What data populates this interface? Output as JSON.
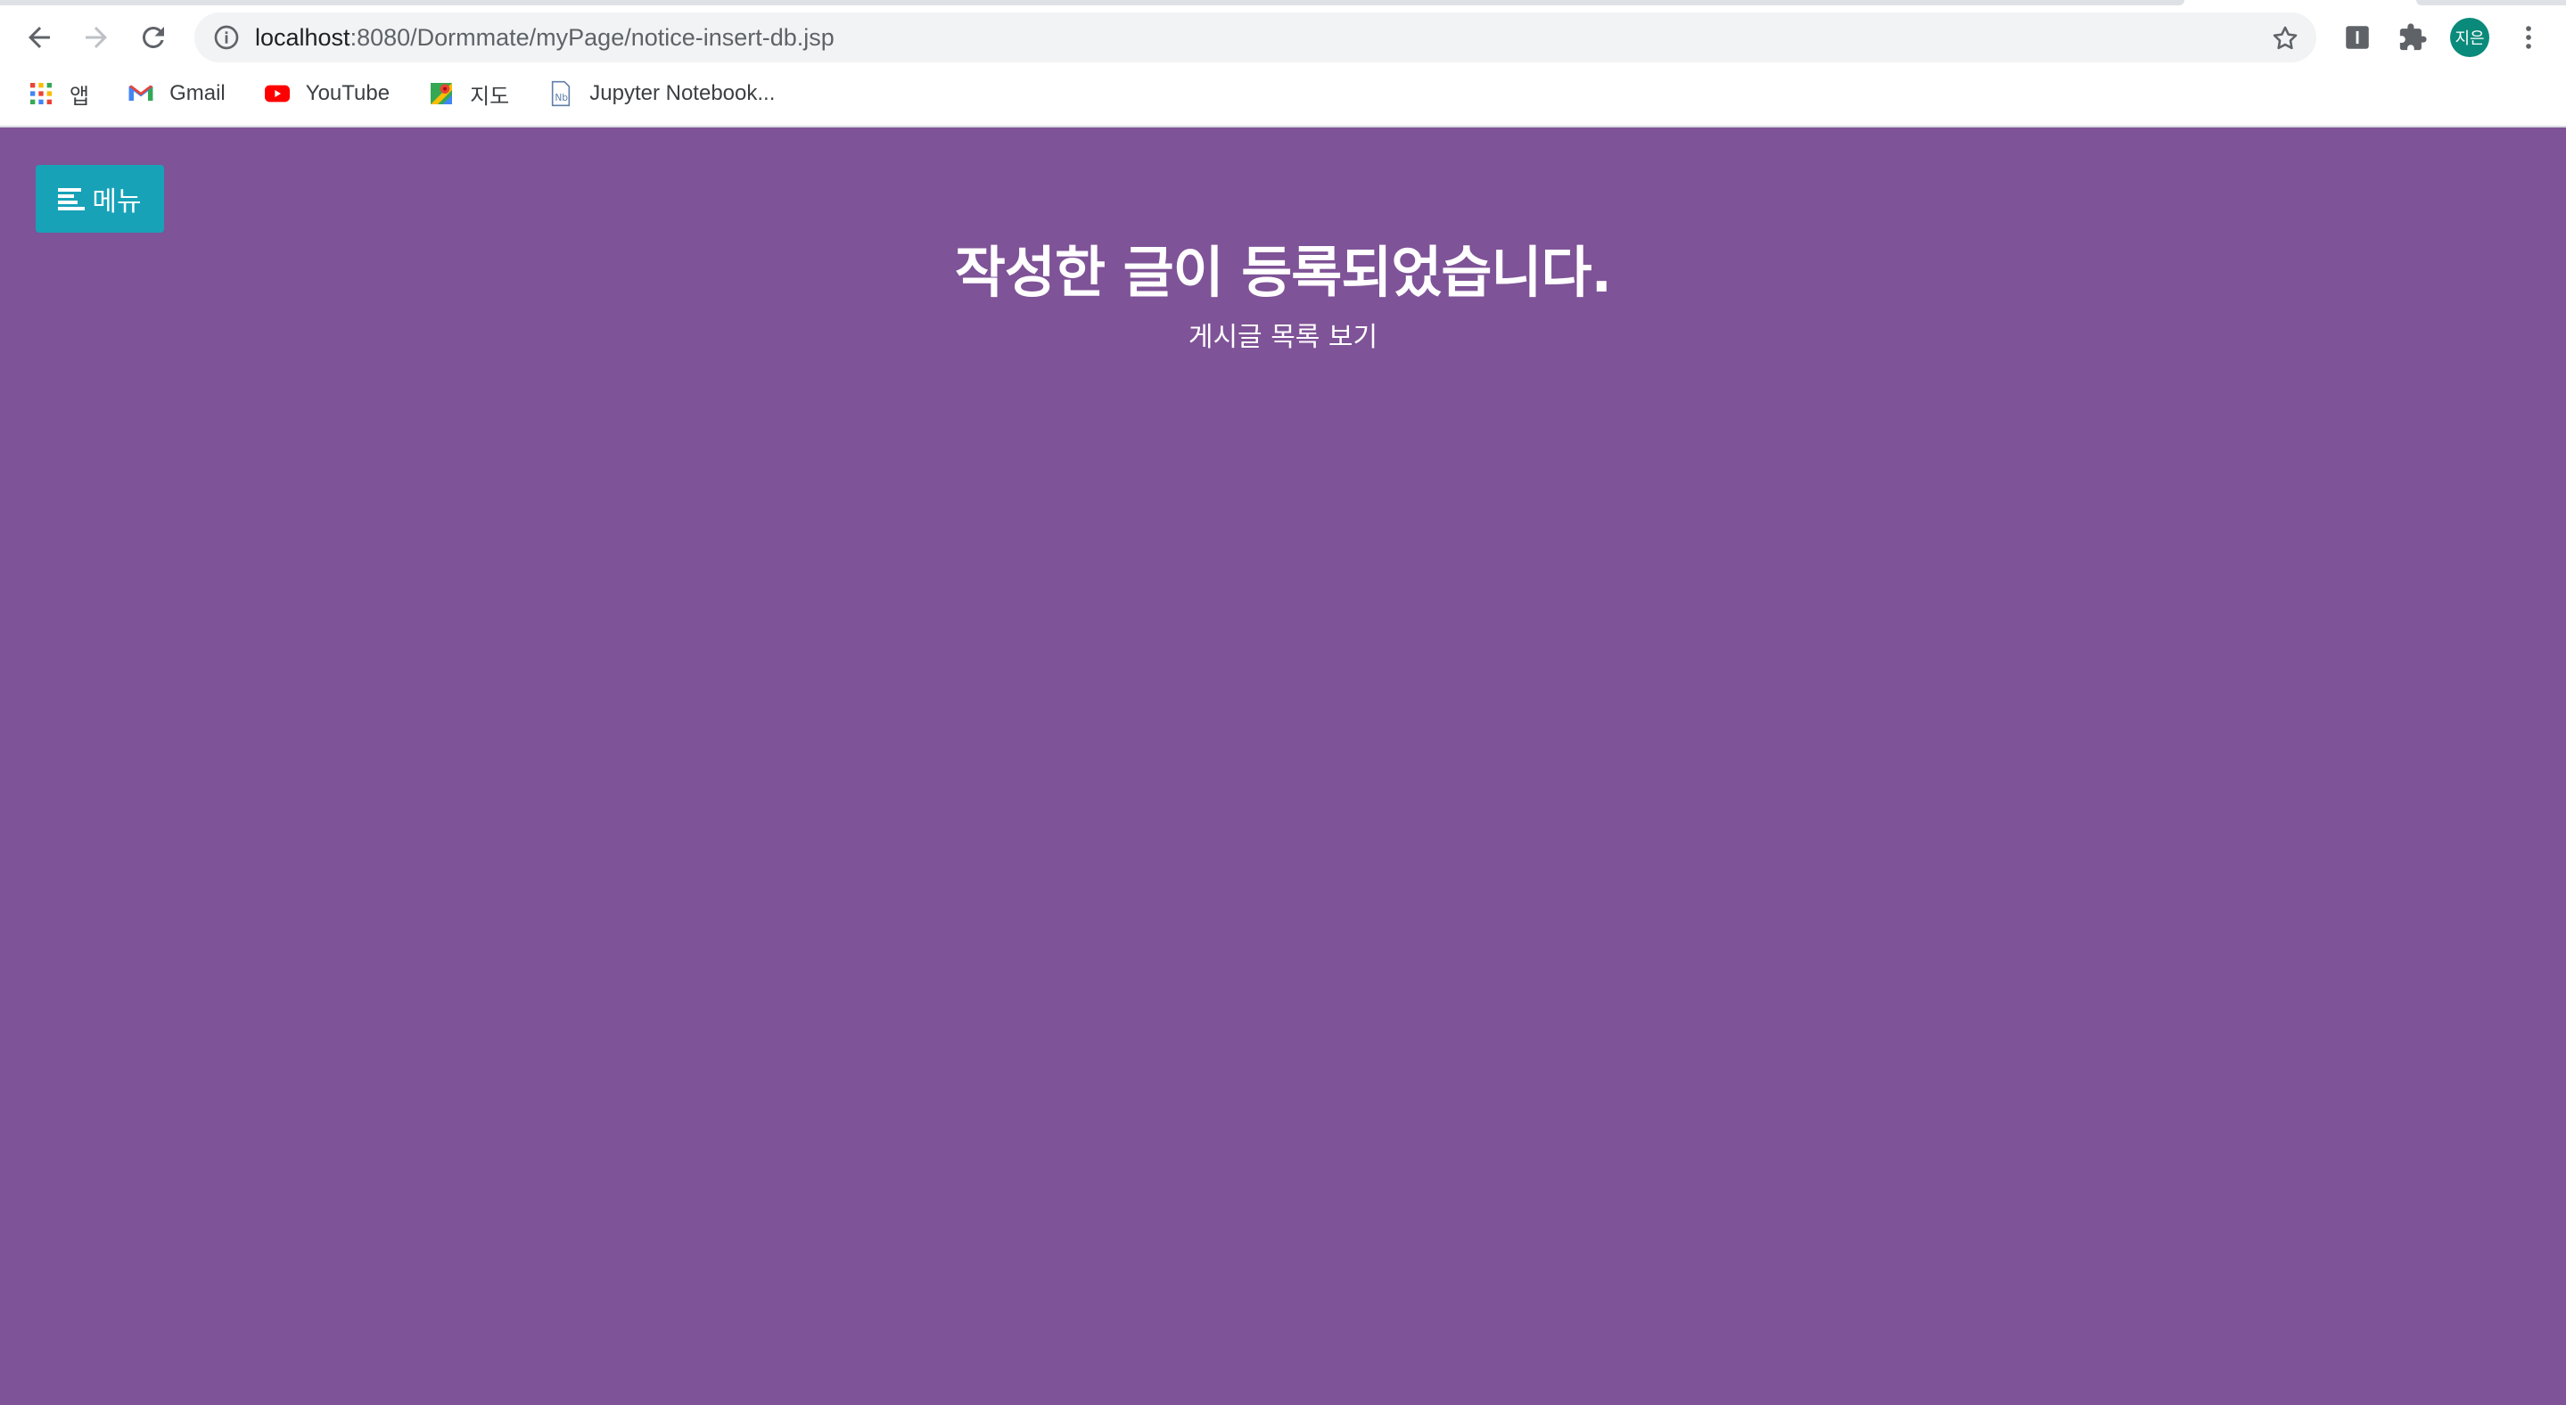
{
  "browser": {
    "url_host": "localhost",
    "url_rest": ":8080/Dormmate/myPage/notice-insert-db.jsp",
    "profile_initials": "지은",
    "bookmarks": [
      {
        "label": "앱",
        "icon": "apps-grid-icon"
      },
      {
        "label": "Gmail",
        "icon": "gmail-icon"
      },
      {
        "label": "YouTube",
        "icon": "youtube-icon"
      },
      {
        "label": "지도",
        "icon": "maps-icon"
      },
      {
        "label": "Jupyter Notebook...",
        "icon": "jupyter-icon"
      }
    ]
  },
  "page": {
    "background_color": "#7f5397",
    "menu_button": {
      "label": "메뉴",
      "color": "#17a2b8",
      "icon": "menu-bars-icon"
    },
    "message": "작성한 글이 등록되었습니다.",
    "list_link": "게시글 목록 보기"
  }
}
